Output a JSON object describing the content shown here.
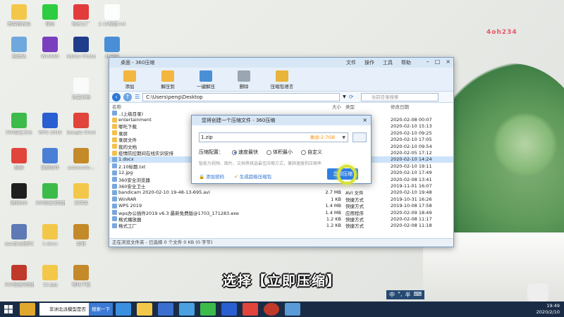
{
  "desktop": {
    "icons": [
      {
        "label": "图库回收站",
        "color": "#f3c84a"
      },
      {
        "label": "微信",
        "color": "#2ecc40"
      },
      {
        "label": "格式工厂",
        "color": "#e23b3b"
      },
      {
        "label": "2.10标题.txt",
        "color": "#fdfdfd"
      },
      {
        "label": "回收站",
        "color": "#6fa8dc"
      },
      {
        "label": "WinRAR",
        "color": "#7a3fbf"
      },
      {
        "label": "Adobe Photosho...",
        "color": "#1f3d8a"
      },
      {
        "label": "此电脑",
        "color": "#4a8fd6"
      },
      {
        "label": "石墨文档",
        "color": "#fafafa"
      },
      {
        "label": "360安全卫士",
        "color": "#3dbb4a"
      },
      {
        "label": "WPS 2019",
        "color": "#2a5fd1"
      },
      {
        "label": "Google Chrome",
        "color": "#e0443a"
      },
      {
        "label": "酷狗",
        "color": "#e0443a"
      },
      {
        "label": "录屏软件",
        "color": "#4a7fd6"
      },
      {
        "label": "autorunin...",
        "color": "#c48a2a"
      },
      {
        "label": "腾讯QQ",
        "color": "#1f1f1f"
      },
      {
        "label": "360安全浏览器",
        "color": "#3dbb4a"
      },
      {
        "label": "文件夹",
        "color": "#f3c84a"
      },
      {
        "label": "wps办公插件2019 v6.3...",
        "color": "#5d7ab5"
      },
      {
        "label": "1.docx",
        "color": "#f3c84a"
      },
      {
        "label": "素材",
        "color": "#c48a2a"
      },
      {
        "label": "360极速浏览器",
        "color": "#c0392b"
      },
      {
        "label": "12.jpg",
        "color": "#f3c84a"
      },
      {
        "label": "哪吒下载",
        "color": "#c48a2a"
      }
    ],
    "logo_text": "4oh234"
  },
  "window": {
    "title": "桌面 - 360压缩",
    "menus": [
      "文件",
      "操作",
      "工具",
      "帮助"
    ],
    "toolbar": [
      "添加",
      "解压到",
      "一键解压",
      "删除",
      "压缩包语言"
    ],
    "address": "C:\\Users\\peng\\Desktop",
    "search_placeholder": "当前目录搜索",
    "columns": {
      "name": "名称",
      "size": "大小",
      "type": "类型",
      "date": "修改日期"
    },
    "files": [
      {
        "name": "..(上级目录)",
        "size": "",
        "type": "",
        "date": ""
      },
      {
        "name": "entertainment",
        "size": "",
        "type": "文件夹",
        "date": "2020-02-08 00:07"
      },
      {
        "name": "哪吒下载",
        "size": "",
        "type": "文件夹",
        "date": "2020-02-10 15:13"
      },
      {
        "name": "录屏",
        "size": "",
        "type": "文件夹",
        "date": "2020-02-10 09:25"
      },
      {
        "name": "录屏文件",
        "size": "",
        "type": "文件夹",
        "date": "2020-02-10 17:05"
      },
      {
        "name": "我的文档",
        "size": "",
        "type": "文件夹",
        "date": "2020-02-10 09:54"
      },
      {
        "name": "疫情防控期间在线实训安排",
        "size": "",
        "type": "文件夹",
        "date": "2020-02-05 17:12"
      },
      {
        "name": "1.docx",
        "size": "",
        "type": "",
        "date": "2020-02-10 14:24"
      },
      {
        "name": "2.10标题.txt",
        "size": "",
        "type": "",
        "date": "2020-02-10 19:11"
      },
      {
        "name": "12.jpg",
        "size": "",
        "type": "",
        "date": "2020-02-10 17:49"
      },
      {
        "name": "360安全浏览器",
        "size": "",
        "type": "",
        "date": "2020-02-08 13:41"
      },
      {
        "name": "360安全卫士",
        "size": "",
        "type": "",
        "date": "2019-11-01 16:07"
      },
      {
        "name": "bandicam 2020-02-10 19-48-13-695.avi",
        "size": "2.7 MB",
        "type": "AVI 文件",
        "date": "2020-02-10 19:48"
      },
      {
        "name": "WinRAR",
        "size": "1 KB",
        "type": "快捷方式",
        "date": "2019-10-31 16:26"
      },
      {
        "name": "WPS 2019",
        "size": "1.4 MB",
        "type": "快捷方式",
        "date": "2019-10-08 17:58"
      },
      {
        "name": "wps办公插件2019 v6.3 最新免费版@1703_171283.exe",
        "size": "1.4 MB",
        "type": "应用程序",
        "date": "2020-02-09 18:49"
      },
      {
        "name": "格式播放器",
        "size": "1.2 KB",
        "type": "快捷方式",
        "date": "2020-02-08 11:17"
      },
      {
        "name": "格式工厂",
        "size": "1.2 KB",
        "type": "快捷方式",
        "date": "2020-02-08 11:18"
      }
    ],
    "status": "正在浏览文件夹 - 已选择 0 个文件 0 KB (0 字节)"
  },
  "dialog": {
    "title": "您将创建一个压缩文件 - 360压缩",
    "filename": "1.zip",
    "remaining": "剩余:2.7GB",
    "config_label": "压缩配置：",
    "options": [
      "速度最快",
      "体积最小",
      "自定义"
    ],
    "selected_option": 0,
    "note": "智能为视频、图片、文档等挑选最佳压缩方式，兼顾速度和压缩率",
    "link_password": "添加密码",
    "link_sfx": "生成超级压缩包",
    "compress_button": "立即压缩"
  },
  "caption": "选择【立即压缩】",
  "taskbar": {
    "search_text": "非洲北派模型是否能...",
    "search_button": "搜索一下",
    "time": "19:49",
    "date": "2020/2/10",
    "ime_cn": "中",
    "ime_dot": "°,",
    "ime_half": "半"
  }
}
